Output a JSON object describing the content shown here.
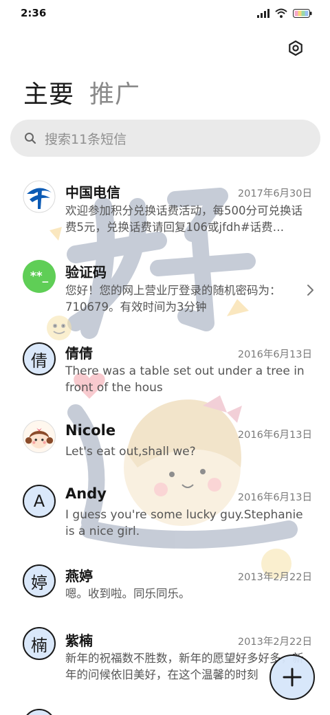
{
  "status_bar": {
    "time": "2:36",
    "icons": [
      "signal-icon",
      "wifi-icon",
      "battery-icon"
    ]
  },
  "header": {
    "settings_icon": "gear-icon",
    "tabs": [
      {
        "label": "主要",
        "active": true
      },
      {
        "label": "推广",
        "active": false
      }
    ]
  },
  "search": {
    "placeholder": "搜索11条短信",
    "icon": "search-icon"
  },
  "messages": [
    {
      "sender": "中国电信",
      "date": "2017年6月30日",
      "preview": "欢迎参加积分兑换话费活动，每500分可兑换话费5元，兑换话费请回复106或jfdh#话费…",
      "avatar": "china-telecom-logo"
    },
    {
      "sender": "验证码",
      "date": "",
      "preview": "您好！您的网上营业厅登录的随机密码为：710679。有效时间为3分钟",
      "avatar_text": "**_",
      "avatar_color": "#5fce56"
    },
    {
      "sender": "倩倩",
      "date": "2016年6月13日",
      "preview": "There was a table set out under a tree in front of the hous",
      "avatar_text": "倩"
    },
    {
      "sender": "Nicole",
      "date": "2016年6月13日",
      "preview": "Let's eat out,shall we?",
      "avatar": "girl-avatar"
    },
    {
      "sender": "Andy",
      "date": "2016年6月13日",
      "preview": "I guess you're some lucky guy.Stephanie is a nice girl.",
      "avatar_text": "A"
    },
    {
      "sender": "燕婷",
      "date": "2013年2月22日",
      "preview": "嗯。收到啦。同乐同乐。",
      "avatar_text": "婷"
    },
    {
      "sender": "紫楠",
      "date": "2013年2月22日",
      "preview": "新年的祝福数不胜数，新年的愿望好多好多，新年的问候依旧美好，在这个温馨的时刻",
      "avatar_text": "楠"
    }
  ],
  "fab": {
    "icon": "plus-icon"
  }
}
